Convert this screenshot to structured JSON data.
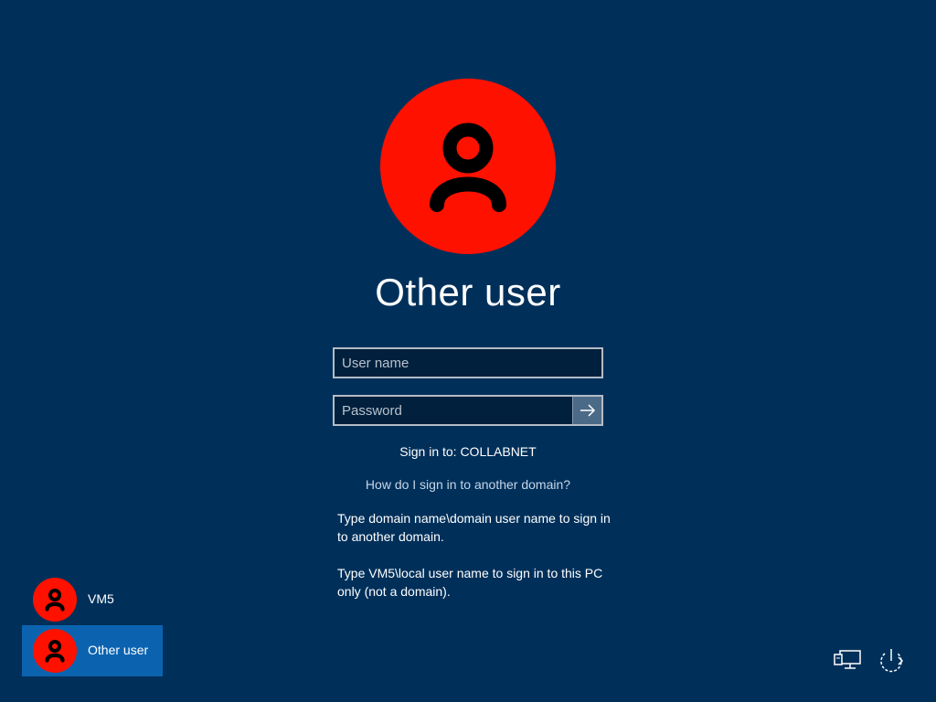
{
  "login": {
    "selected_user": "Other user",
    "avatar_icon": "user-avatar-icon",
    "avatar_color": "#ff1100",
    "username_placeholder": "User name",
    "password_placeholder": "Password",
    "submit_icon": "arrow-right-icon",
    "sign_in_to": "Sign in to: COLLABNET",
    "domain_link": "How do I sign in to another domain?",
    "help_line_1": "Type domain name\\domain user name to sign in to another domain.",
    "help_line_2": "Type VM5\\local user name to sign in to this PC only (not a domain)."
  },
  "user_list": [
    {
      "label": "VM5",
      "avatar_icon": "user-avatar-icon"
    },
    {
      "label": "Other user",
      "avatar_icon": "user-avatar-icon",
      "selected": true
    }
  ],
  "bottom_icons": {
    "network": "network-icon",
    "power": "power-icon"
  },
  "colors": {
    "background": "#00305a",
    "selected_tile": "#0b63b0",
    "avatar": "#ff1100"
  }
}
